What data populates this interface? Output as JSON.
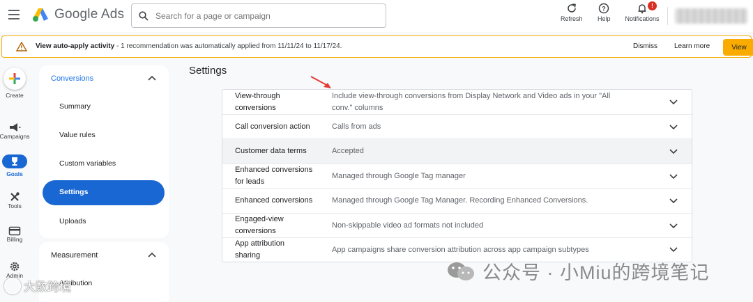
{
  "header": {
    "app_name": "Google Ads",
    "search_placeholder": "Search for a page or campaign",
    "actions": {
      "refresh": "Refresh",
      "help": "Help",
      "notifications": "Notifications"
    },
    "notification_badge": "!"
  },
  "banner": {
    "title": "View auto-apply activity",
    "message": " - 1 recommendation was automatically applied from 11/11/24 to 11/17/24.",
    "dismiss": "Dismiss",
    "learn_more": "Learn more",
    "view": "View"
  },
  "rail": {
    "create": "Create",
    "campaigns": "Campaigns",
    "goals": "Goals",
    "tools": "Tools",
    "billing": "Billing",
    "admin": "Admin"
  },
  "sidenav": {
    "conversions_header": "Conversions",
    "items": [
      "Summary",
      "Value rules",
      "Custom variables",
      "Settings",
      "Uploads"
    ],
    "measurement_header": "Measurement",
    "measurement_items": [
      "Attribution"
    ]
  },
  "page": {
    "title": "Settings"
  },
  "settings_rows": [
    {
      "label_lines": [
        "View-through",
        "conversions"
      ],
      "value_lines": [
        "Include view-through conversions from Display Network and Video ads in your \"All",
        "conv.\" columns"
      ]
    },
    {
      "label_lines": [
        "Call conversion action"
      ],
      "value_lines": [
        "Calls from ads"
      ]
    },
    {
      "label_lines": [
        "Customer data terms"
      ],
      "value_lines": [
        "Accepted"
      ]
    },
    {
      "label_lines": [
        "Enhanced conversions",
        "for leads"
      ],
      "value_lines": [
        "Managed through Google Tag manager"
      ]
    },
    {
      "label_lines": [
        "Enhanced conversions"
      ],
      "value_lines": [
        "Managed through Google Tag Manager. Recording Enhanced Conversions."
      ]
    },
    {
      "label_lines": [
        "Engaged-view",
        "conversions"
      ],
      "value_lines": [
        "Non-skippable video ad formats not included"
      ]
    },
    {
      "label_lines": [
        "App attribution",
        "sharing"
      ],
      "value_lines": [
        "App campaigns share conversion attribution across app campaign subtypes"
      ]
    }
  ],
  "watermarks": {
    "wechat": "公众号 · 小Miu的跨境笔记",
    "corner": "大数跨境"
  },
  "colors": {
    "primary_blue": "#1967d2",
    "link_blue": "#1a73e8",
    "banner_amber": "#f9ab00",
    "badge_red": "#d93025"
  }
}
